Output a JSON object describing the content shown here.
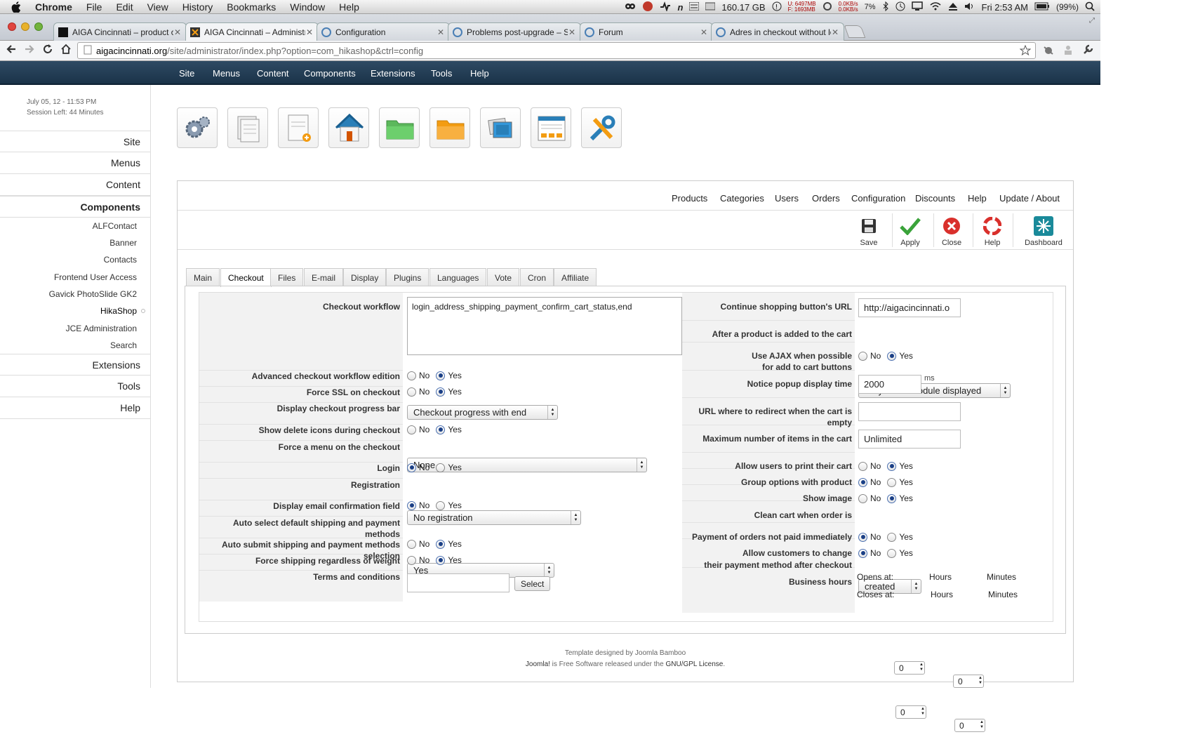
{
  "mac_menu": {
    "app": "Chrome",
    "items": [
      "File",
      "Edit",
      "View",
      "History",
      "Bookmarks",
      "Window",
      "Help"
    ],
    "status": {
      "disk": "160.17 GB",
      "mem_u": "U: 6497MB",
      "mem_f": "F: 1693MB",
      "net_up": "0.0KB/s",
      "net_down": "0.0KB/s",
      "cpu": "7%",
      "clock": "Fri 2:53 AM",
      "battery": "(99%)"
    }
  },
  "browser": {
    "tabs": [
      {
        "title": "AIGA Cincinnati – product ca",
        "active": false
      },
      {
        "title": "AIGA Cincinnati – Administra",
        "active": true
      },
      {
        "title": "Configuration",
        "active": false
      },
      {
        "title": "Problems post-upgrade – St",
        "active": false
      },
      {
        "title": "Forum",
        "active": false
      },
      {
        "title": "Adres in checkout without lo",
        "active": false
      }
    ],
    "url_host": "aigacincinnati.org",
    "url_path": "/site/administrator/index.php?option=com_hikashop&ctrl=config"
  },
  "joomla_nav": [
    "Site",
    "Menus",
    "Content",
    "Components",
    "Extensions",
    "Tools",
    "Help"
  ],
  "sidebar": {
    "date": "July 05, 12 - 11:53 PM",
    "session": "Session Left: 44 Minutes",
    "menu_top": [
      "Site",
      "Menus",
      "Content"
    ],
    "components_label": "Components",
    "components": [
      "ALFContact",
      "Banner",
      "Contacts",
      "Frontend User Access",
      "Gavick PhotoSlide GK2",
      "HikaShop",
      "JCE Administration",
      "Search"
    ],
    "menu_bottom": [
      "Extensions",
      "Tools",
      "Help"
    ]
  },
  "hika_nav": [
    "Products",
    "Categories",
    "Users",
    "Orders",
    "Configuration",
    "Discounts",
    "Help",
    "Update / About"
  ],
  "toolbar": {
    "save": "Save",
    "apply": "Apply",
    "close": "Close",
    "help": "Help",
    "dashboard": "Dashboard"
  },
  "config_tabs": [
    "Main",
    "Checkout",
    "Files",
    "E-mail",
    "Display",
    "Plugins",
    "Languages",
    "Vote",
    "Cron",
    "Affiliate"
  ],
  "active_tab": "Checkout",
  "left_form": {
    "checkout_workflow_label": "Checkout workflow",
    "checkout_workflow_value": "login_address_shipping_payment_confirm_cart_status,end",
    "advanced_label": "Advanced checkout workflow edition",
    "force_ssl_label": "Force SSL on checkout",
    "progress_label": "Display checkout progress bar",
    "progress_value": "Checkout progress with end",
    "delete_icons_label": "Show delete icons during checkout",
    "force_menu_label": "Force a menu on the checkout",
    "force_menu_value": "None",
    "login_label": "Login",
    "registration_label": "Registration",
    "registration_value": "No registration",
    "email_confirm_label": "Display email confirmation field",
    "auto_select_label": "Auto select default shipping and payment methods",
    "auto_select_value": "Yes",
    "auto_submit_label": "Auto submit shipping and payment methods selection",
    "force_shipping_label": "Force shipping regardless of weight",
    "terms_label": "Terms and conditions",
    "terms_value": "",
    "select_button": "Select"
  },
  "right_form": {
    "continue_url_label": "Continue shopping button's URL",
    "continue_url_value": "http://aigacincinnati.o",
    "after_add_label": "After a product is added to the cart",
    "after_add_value": "Stay if cart module displayed",
    "ajax_label_1": "Use AJAX when possible",
    "ajax_label_2": "for add to cart buttons",
    "notice_label": "Notice popup display time",
    "notice_value": "2000",
    "notice_unit": "ms",
    "empty_url_label": "URL where to redirect when the cart is empty",
    "empty_url_value": "",
    "max_items_label": "Maximum number of items in the cart",
    "max_items_value": "Unlimited",
    "print_label": "Allow users to print their cart",
    "group_label": "Group options with product",
    "image_label": "Show image",
    "clean_label": "Clean cart when order is",
    "clean_value": "created",
    "payment_label": "Payment of orders not paid immediately",
    "change_label_1": "Allow customers to change",
    "change_label_2": "their payment method after checkout",
    "hours_label": "Business hours",
    "opens_at": "Opens at:",
    "closes_at": "Closes at:",
    "hours": "Hours",
    "minutes": "Minutes",
    "open_h": "0",
    "open_m": "0",
    "close_h": "0",
    "close_m": "0"
  },
  "radio": {
    "no": "No",
    "yes": "Yes"
  },
  "footer": {
    "line1": "Template designed by Joomla Bamboo",
    "joomla": "Joomla!",
    "middle": " is Free Software released under the ",
    "license": "GNU/GPL License",
    "end": "."
  }
}
